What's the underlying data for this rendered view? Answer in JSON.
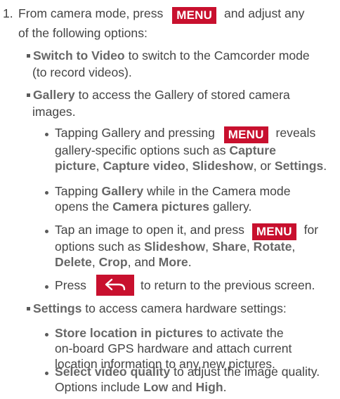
{
  "menu_key_label": "MENU",
  "step": {
    "number": "1.",
    "intro_a": "From camera mode, press",
    "intro_b": "and adjust any",
    "intro_c": "of the following options:"
  },
  "options": [
    {
      "term": "Switch to Video",
      "desc_a": "to switch to the Camcorder mode",
      "desc_b": "(to record videos)."
    },
    {
      "term": "Gallery",
      "desc_a": "to access the Gallery of stored camera",
      "desc_b": "images.",
      "bullets": [
        {
          "l1_a": "Tapping Gallery and pressing",
          "l1_b": "reveals",
          "l2_a": "gallery-specific options such as",
          "l2_b": "Capture",
          "l3_a": "picture",
          "l3_b": ",",
          "l3_c": "Capture video",
          "l3_d": ",",
          "l3_e": "Slideshow",
          "l3_f": ", or",
          "l3_g": "Settings",
          "l3_h": "."
        },
        {
          "l1_a": "Tapping",
          "l1_b": "Gallery",
          "l1_c": "while in the Camera mode",
          "l2_a": "opens the",
          "l2_b": "Camera pictures",
          "l2_c": "gallery."
        },
        {
          "l1_a": "Tap an image to open it, and press",
          "l1_b": "for",
          "l2_a": "options such as",
          "l2_b": "Slideshow",
          "l2_c": ",",
          "l2_d": "Share",
          "l2_e": ",",
          "l2_f": "Rotate",
          "l2_g": ",",
          "l3_a": "Delete",
          "l3_b": ",",
          "l3_c": "Crop",
          "l3_d": ", and",
          "l3_e": "More",
          "l3_f": "."
        },
        {
          "l1_a": "Press",
          "l1_b": "to return to the previous screen."
        }
      ]
    },
    {
      "term": "Settings",
      "desc_a": "to access camera hardware settings:",
      "bullets": [
        {
          "l1_a": "Store location in pictures",
          "l1_b": "to activate the",
          "l2": "on-board GPS hardware and attach current",
          "l3": "location information to any new pictures."
        },
        {
          "l1_a": "Select video quality",
          "l1_b": "to adjust the image quality.",
          "l2_a": "Options include",
          "l2_b": "Low",
          "l2_c": "and",
          "l2_d": "High",
          "l2_e": "."
        }
      ]
    }
  ]
}
